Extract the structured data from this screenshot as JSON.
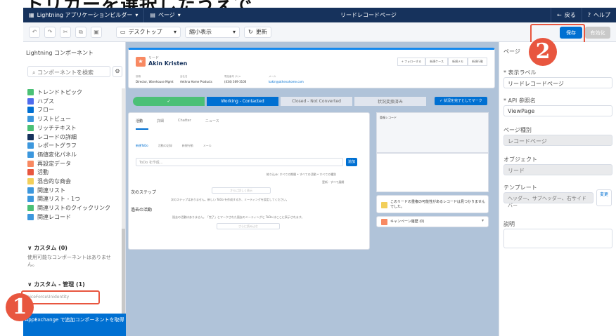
{
  "caption": "トリガーを選択したうえで",
  "topbar": {
    "app_title": "Lightning アプリケーションビルダー",
    "page_menu": "ページ",
    "center_title": "リードレコードページ",
    "back": "戻る",
    "help": "ヘルプ"
  },
  "toolbar": {
    "device": "デスクトップ",
    "view": "縮小表示",
    "refresh": "更新",
    "save": "保存",
    "activate": "有効化"
  },
  "left_panel": {
    "title": "Lightning コンポーネント",
    "search_placeholder": "コンポーネントを検索",
    "components": [
      {
        "label": "トレンドトピック",
        "color": "#4bc076"
      },
      {
        "label": "ハブス",
        "color": "#4f6bed"
      },
      {
        "label": "フロー",
        "color": "#0070d2"
      },
      {
        "label": "リストビュー",
        "color": "#3c97dd"
      },
      {
        "label": "リッチテキスト",
        "color": "#4bc076"
      },
      {
        "label": "レコードの詳細",
        "color": "#16325c"
      },
      {
        "label": "レポートグラフ",
        "color": "#3c97dd"
      },
      {
        "label": "価値変化パネル",
        "color": "#3c97dd"
      },
      {
        "label": "再設定データ",
        "color": "#f88962"
      },
      {
        "label": "活動",
        "color": "#e8563f"
      },
      {
        "label": "混合的な商会",
        "color": "#f2cf5b"
      },
      {
        "label": "関連リスト",
        "color": "#3c97dd"
      },
      {
        "label": "関連リスト - 1つ",
        "color": "#3c97dd"
      },
      {
        "label": "関連リストのクイックリンク",
        "color": "#4bc076"
      },
      {
        "label": "関連レコード",
        "color": "#3c97dd"
      }
    ],
    "custom_section": "カスタム (0)",
    "custom_note": "使用可能なコンポーネントはありません。",
    "managed_section": "カスタム - 管理 (1)",
    "managed_item": "voiceForceUnidentity",
    "footer": "AppExchange で追加コンポーネントを取得"
  },
  "record": {
    "type_label": "リード",
    "name": "Akin Kristen",
    "fields": [
      {
        "label": "役職",
        "value": "Director, Warehouse Mgmt"
      },
      {
        "label": "会社名",
        "value": "Aethna Home Products"
      },
      {
        "label": "電話番号 (2) ▾",
        "value": "(434) 369-3100"
      },
      {
        "label": "メール",
        "value": "kakin@athenahome.com"
      }
    ],
    "actions": [
      "+ フォローする",
      "新規ケース",
      "新規メモ",
      "新規行動"
    ],
    "path_steps": [
      "✓",
      "Working - Contacted",
      "Closed - Not Converted",
      "状況変換済み"
    ],
    "path_button": "✓ 状況を完了としてマーク",
    "tabs": [
      "活動",
      "詳細",
      "Chatter",
      "ニュース"
    ],
    "activity_subtabs": [
      "新規ToDo",
      "活動の記録",
      "新規行動",
      "メール"
    ],
    "todo_placeholder": "ToDo を作成...",
    "add_button": "追加",
    "filter_text": "絞り込み: すべての期間 • すべての活動 • すべての種別",
    "expand_text": "更新 · すべて展開",
    "next_steps": "次のステップ",
    "next_steps_button": "さらに詳しく表示",
    "next_steps_note": "次のステップはありません。新しい ToDo を作成するか、ミーティングを設定してください。",
    "past_activity": "過去の活動",
    "past_note": "過去の活動はありません。「完了」とマークされた過去のミーティングと ToDo はここに表示されます。",
    "load_more": "さらに読み込む",
    "duplicate_title": "重複レコード",
    "duplicate_note": "このリードの重複の可能性があるレコードは見つかりませんでした。",
    "campaign": "キャンペーン履歴 (0)"
  },
  "right_panel": {
    "section": "ページ",
    "label_label": "* 表示ラベル",
    "label_value": "リードレコードページ",
    "api_label": "* API 参照名",
    "api_value": "ViewPage",
    "type_label": "ページ種別",
    "type_value": "レコードページ",
    "object_label": "オブジェクト",
    "object_value": "リード",
    "template_label": "テンプレート",
    "template_value": "ヘッダー、サブヘッダー、右サイドバー",
    "change_btn": "変更",
    "desc_label": "説明"
  },
  "badges": [
    "1",
    "2"
  ]
}
